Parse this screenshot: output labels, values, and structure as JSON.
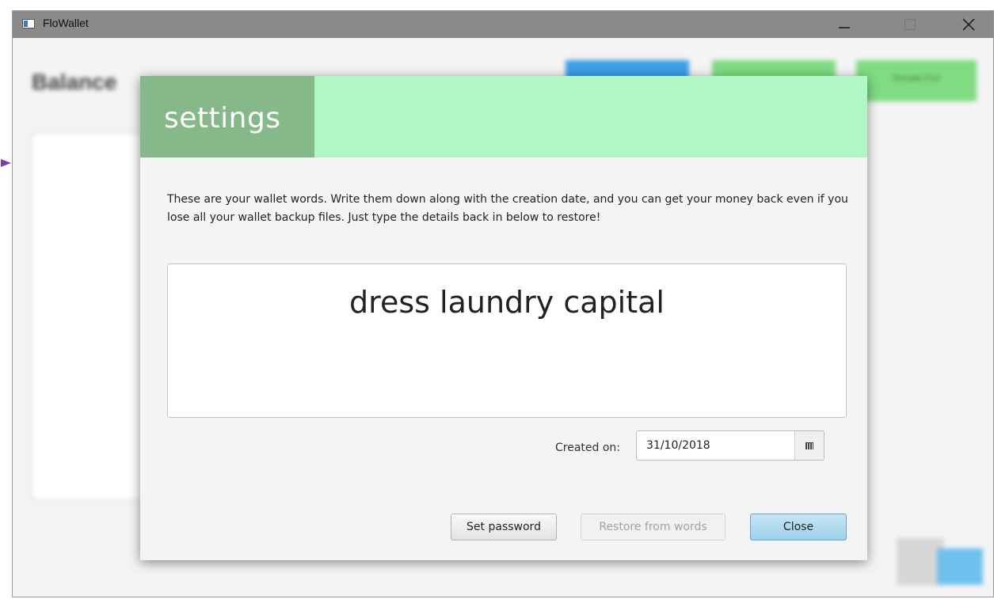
{
  "window": {
    "title": "FloWallet",
    "minimize_icon": "minimize-icon",
    "maximize_icon": "maximize-icon",
    "close_icon": "close-icon"
  },
  "background": {
    "balance_label": "Balance",
    "buttons": [
      "",
      "",
      "Donate FLO"
    ]
  },
  "dialog": {
    "title": "settings",
    "header_color": "#b1f7c3",
    "title_box_color": "#86b88a",
    "description": "These are your wallet words. Write them down along with the creation date, and you can get your money back even if you lose all your wallet backup files. Just type the details back in below to restore!",
    "wallet_words": "dress laundry capital",
    "created_label": "Created on:",
    "created_date": "31/10/2018",
    "calendar_icon": "calendar-icon",
    "buttons": {
      "set_password": "Set password",
      "restore": "Restore from words",
      "close": "Close"
    }
  }
}
